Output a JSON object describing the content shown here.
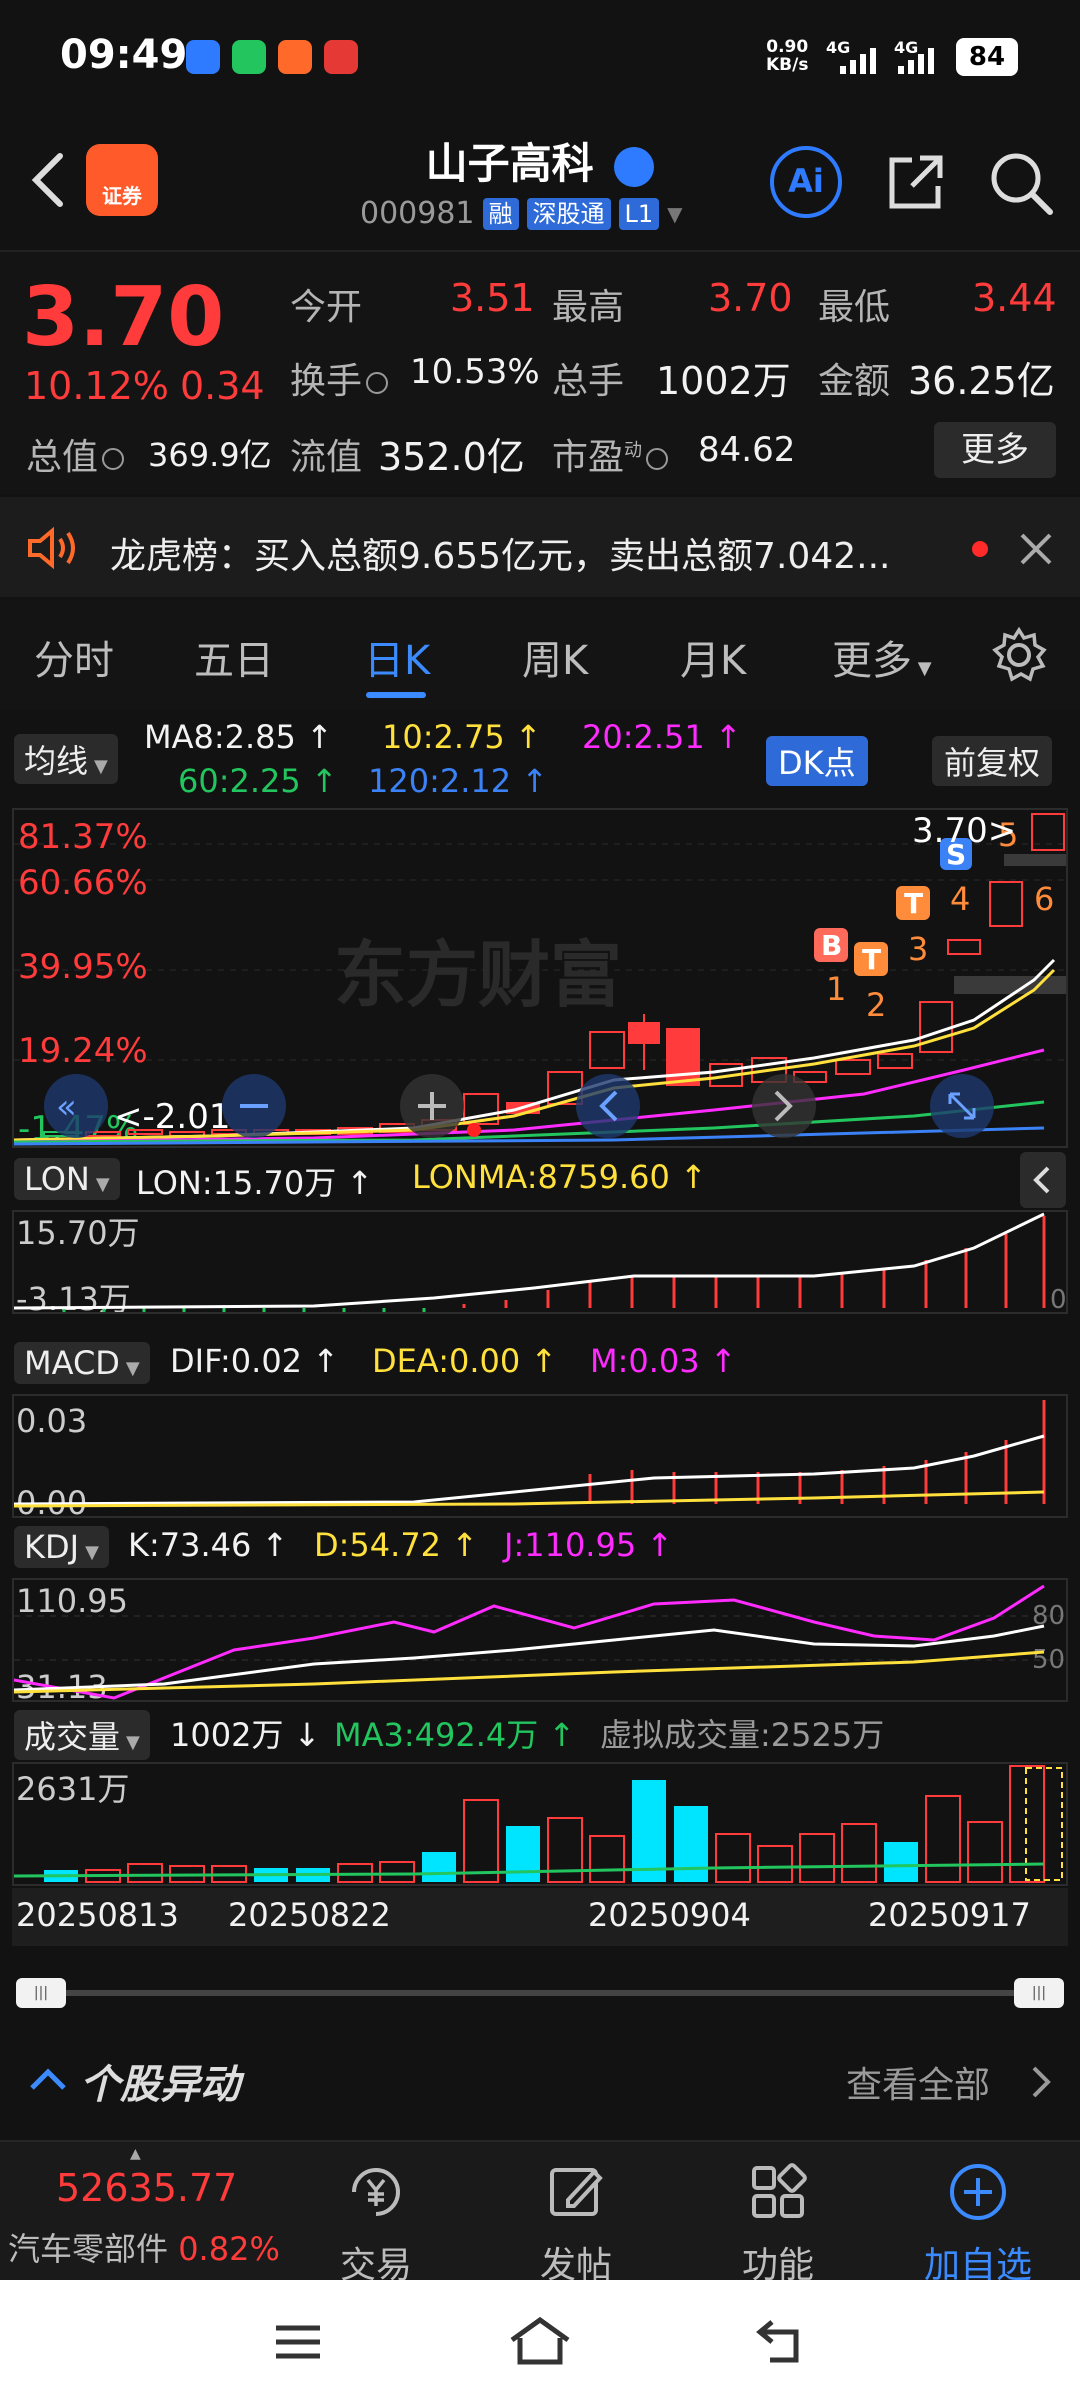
{
  "status_bar": {
    "time": "09:49",
    "net_speed": "0.90",
    "net_unit": "KB/s",
    "signal1": "4G",
    "signal2": "4G",
    "battery": "84"
  },
  "header": {
    "logo_text": "证券",
    "stock_name": "山子高科",
    "stock_code": "000981",
    "tag_rong": "融",
    "tag_sgt": "深股通",
    "tag_l1": "L1",
    "ai_label": "Ai"
  },
  "quote": {
    "price": "3.70",
    "change_pct": "10.12%",
    "change": "0.34",
    "open_label": "今开",
    "open": "3.51",
    "high_label": "最高",
    "high": "3.70",
    "low_label": "最低",
    "low": "3.44",
    "turnover_label": "换手",
    "turnover": "10.53%",
    "volume_label": "总手",
    "volume": "1002万",
    "amount_label": "金额",
    "amount": "36.25亿",
    "mktcap_label": "总值",
    "mktcap": "369.9亿",
    "float_label": "流值",
    "float": "352.0亿",
    "pe_label": "市盈",
    "pe_sup": "动",
    "pe": "84.62",
    "more_label": "更多"
  },
  "notice": {
    "text": "龙虎榜：买入总额9.655亿元，卖出总额7.042..."
  },
  "tabs": [
    {
      "label": "分时"
    },
    {
      "label": "五日"
    },
    {
      "label": "日K"
    },
    {
      "label": "周K"
    },
    {
      "label": "月K"
    },
    {
      "label": "更多"
    }
  ],
  "ma_row": {
    "btn": "均线",
    "ma8": "MA8:2.85 ↑",
    "ma10": "10:2.75 ↑",
    "ma20": "20:2.51 ↑",
    "ma60": "60:2.25 ↑",
    "ma120": "120:2.12 ↑",
    "dk": "DK点",
    "adjust": "前复权"
  },
  "kchart": {
    "axis": [
      "81.37%",
      "60.66%",
      "39.95%",
      "19.24%",
      "-1.47%"
    ],
    "latest": "3.70",
    "latest_arrow": ">",
    "low_marker": "<-2.01",
    "watermark": "东方财富",
    "signals": [
      "B",
      "T",
      "T",
      "S"
    ],
    "signal_nums": [
      "1",
      "2",
      "3",
      "4",
      "5",
      "6"
    ]
  },
  "lon": {
    "btn": "LON",
    "lon": "LON:15.70万 ↑",
    "lonma": "LONMA:8759.60 ↑",
    "top": "15.70万",
    "bottom": "-3.13万",
    "zero": "0"
  },
  "macd": {
    "btn": "MACD",
    "dif": "DIF:0.02 ↑",
    "dea": "DEA:0.00 ↑",
    "m": "M:0.03 ↑",
    "top": "0.03",
    "bottom": "0.00"
  },
  "kdj": {
    "btn": "KDJ",
    "k": "K:73.46 ↑",
    "d": "D:54.72 ↑",
    "j": "J:110.95 ↑",
    "top": "110.95",
    "bottom": "31.13",
    "l80": "80",
    "l50": "50"
  },
  "vol": {
    "btn": "成交量",
    "vol": "1002万 ↓",
    "ma3": "MA3:492.4万 ↑",
    "virtual": "虚拟成交量:2525万",
    "top": "2631万",
    "dates": [
      "20250813",
      "20250822",
      "20250904",
      "20250917"
    ]
  },
  "section": {
    "title": "个股异动",
    "view_all": "查看全部"
  },
  "bottom_bar": {
    "index_value": "52635.77",
    "index_name": "汽车零部件",
    "index_pct": "0.82%",
    "trade": "交易",
    "post": "发帖",
    "func": "功能",
    "add": "加自选"
  },
  "colors": {
    "up": "#ff3b3b",
    "accent": "#3b8bff",
    "ma8": "#ffffff",
    "ma10": "#ffe03c",
    "ma20": "#ff2bff",
    "ma60": "#22c55e",
    "ma120": "#3b82f6",
    "vol_down": "#00e5ff"
  }
}
